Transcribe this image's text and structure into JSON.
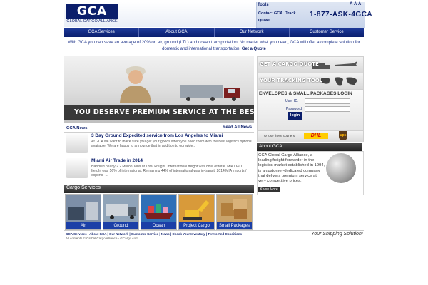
{
  "brand": {
    "logo_text": "GCA",
    "logo_subtitle": "GLOBAL CARGO ALLIANCE"
  },
  "tools": {
    "title": "Tools",
    "text_size": [
      "A",
      "A",
      "A"
    ],
    "links": [
      "Contact GCA",
      "Track",
      "Quote"
    ],
    "phone": "1-877-ASK-4GCA"
  },
  "nav": {
    "items": [
      "GCA Services",
      "About GCA",
      "Our Network",
      "Customer Service"
    ]
  },
  "intro": {
    "text": "With GCA you can save an average of 20% on air, ground (LTL) and ocean transportation. No matter what you need, GCA will offer a complete solution for domestic and international transportation.",
    "link": "Get a Quote"
  },
  "hero": {
    "banner_text": "YOU DESERVE PREMIUM SERVICE AT THE BEST PRICE!"
  },
  "right_panels": {
    "quote": "GET A CARGO QUOTE",
    "track": "YOUR TRACKING TOOL",
    "envelope_title": "ENVELOPES & SMALL PACKAGES LOGIN",
    "userid_label": "User ID:",
    "password_label": "Password:",
    "login_label": "login",
    "couriers_label": "Or use these couriers:",
    "dhl": "DHL",
    "ups": "ups"
  },
  "about": {
    "title": "About GCA",
    "text": "GCA Global Cargo Alliance, a leading freight forwarder in the logistics market established in 1994, is a customer-dedicated company that delivers premium service at very competitive prices.",
    "button": "Know More"
  },
  "news": {
    "title": "GCA News",
    "read_all": "Read All News",
    "items": [
      {
        "title": "3 Day Ground Expedited service from Los Angeles to Miami",
        "desc": "At GCA we want to make sure you get your goods when you need them with the best logistics options available. We are happy to announce that in addition to our wide..."
      },
      {
        "title": "Miami Air Trade in 2014",
        "desc": "Handled nearly 2.2 Million Tons of Total Freight. International freight was 88% of total. MIA O&D freight was 56% of international. Remaining 44% of international was in-transit. 2014 MIA imports / exports -..."
      }
    ]
  },
  "cargo": {
    "title": "Cargo Services",
    "services": [
      "Air",
      "Ground",
      "Ocean",
      "Project Cargo",
      "Small Packages"
    ]
  },
  "footer": {
    "links": [
      "GCA Services",
      "About GCA",
      "Our Network",
      "Customer Service",
      "News",
      "Check Your Inventory",
      "Terms And Conditions"
    ],
    "copyright": "All contents © Global Cargo Alliance - GCargo.com",
    "tagline": "Your Shipping Solution!"
  }
}
